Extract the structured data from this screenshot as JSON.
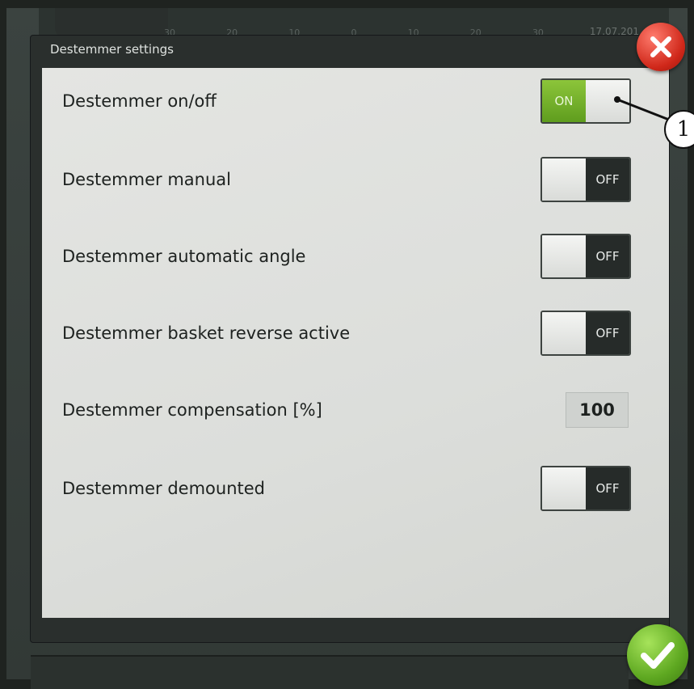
{
  "dialog": {
    "title": "Destemmer settings"
  },
  "rows": [
    {
      "label": "Destemmer on/off",
      "control": "toggle",
      "state": "ON"
    },
    {
      "label": "Destemmer manual",
      "control": "toggle",
      "state": "OFF"
    },
    {
      "label": "Destemmer automatic angle",
      "control": "toggle",
      "state": "OFF"
    },
    {
      "label": "Destemmer basket reverse active",
      "control": "toggle",
      "state": "OFF"
    },
    {
      "label": "Destemmer compensation  [%]",
      "control": "value",
      "value": "100"
    },
    {
      "label": "Destemmer demounted",
      "control": "toggle",
      "state": "OFF"
    }
  ],
  "toggle_text": {
    "on": "ON",
    "off": "OFF"
  },
  "callout": {
    "number": "1"
  },
  "background": {
    "scale": [
      "30",
      "20",
      "10",
      "0",
      "10",
      "20",
      "30"
    ],
    "date": "17.07.201"
  },
  "colors": {
    "on_green": "#6fae2a",
    "off_dark": "#262b29",
    "close_red": "#d0281a",
    "ok_green": "#5ea821"
  },
  "icons": {
    "close": "close-x-icon",
    "confirm": "checkmark-icon"
  }
}
